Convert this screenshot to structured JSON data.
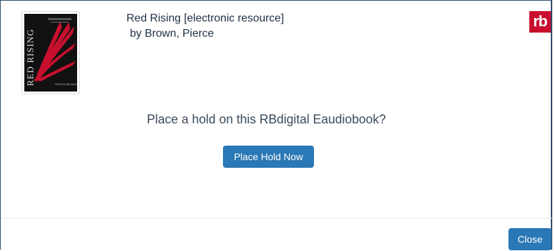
{
  "record": {
    "title": "Red Rising [electronic resource]",
    "author_line": "by Brown, Pierce"
  },
  "cover": {
    "icon": "book-cover-image",
    "title_text": "RED RISING",
    "author_text": "PIERCE BROWN",
    "background_color": "#111111",
    "accent_color": "#c8102e"
  },
  "provider": {
    "logo_text": "rb",
    "color": "#c8102e"
  },
  "dialog": {
    "prompt": "Place a hold on this RBdigital Eaudiobook?",
    "hold_button_label": "Place Hold Now",
    "close_button_label": "Close"
  },
  "colors": {
    "button": "#2a78b5",
    "title_text": "#1f2f44"
  }
}
